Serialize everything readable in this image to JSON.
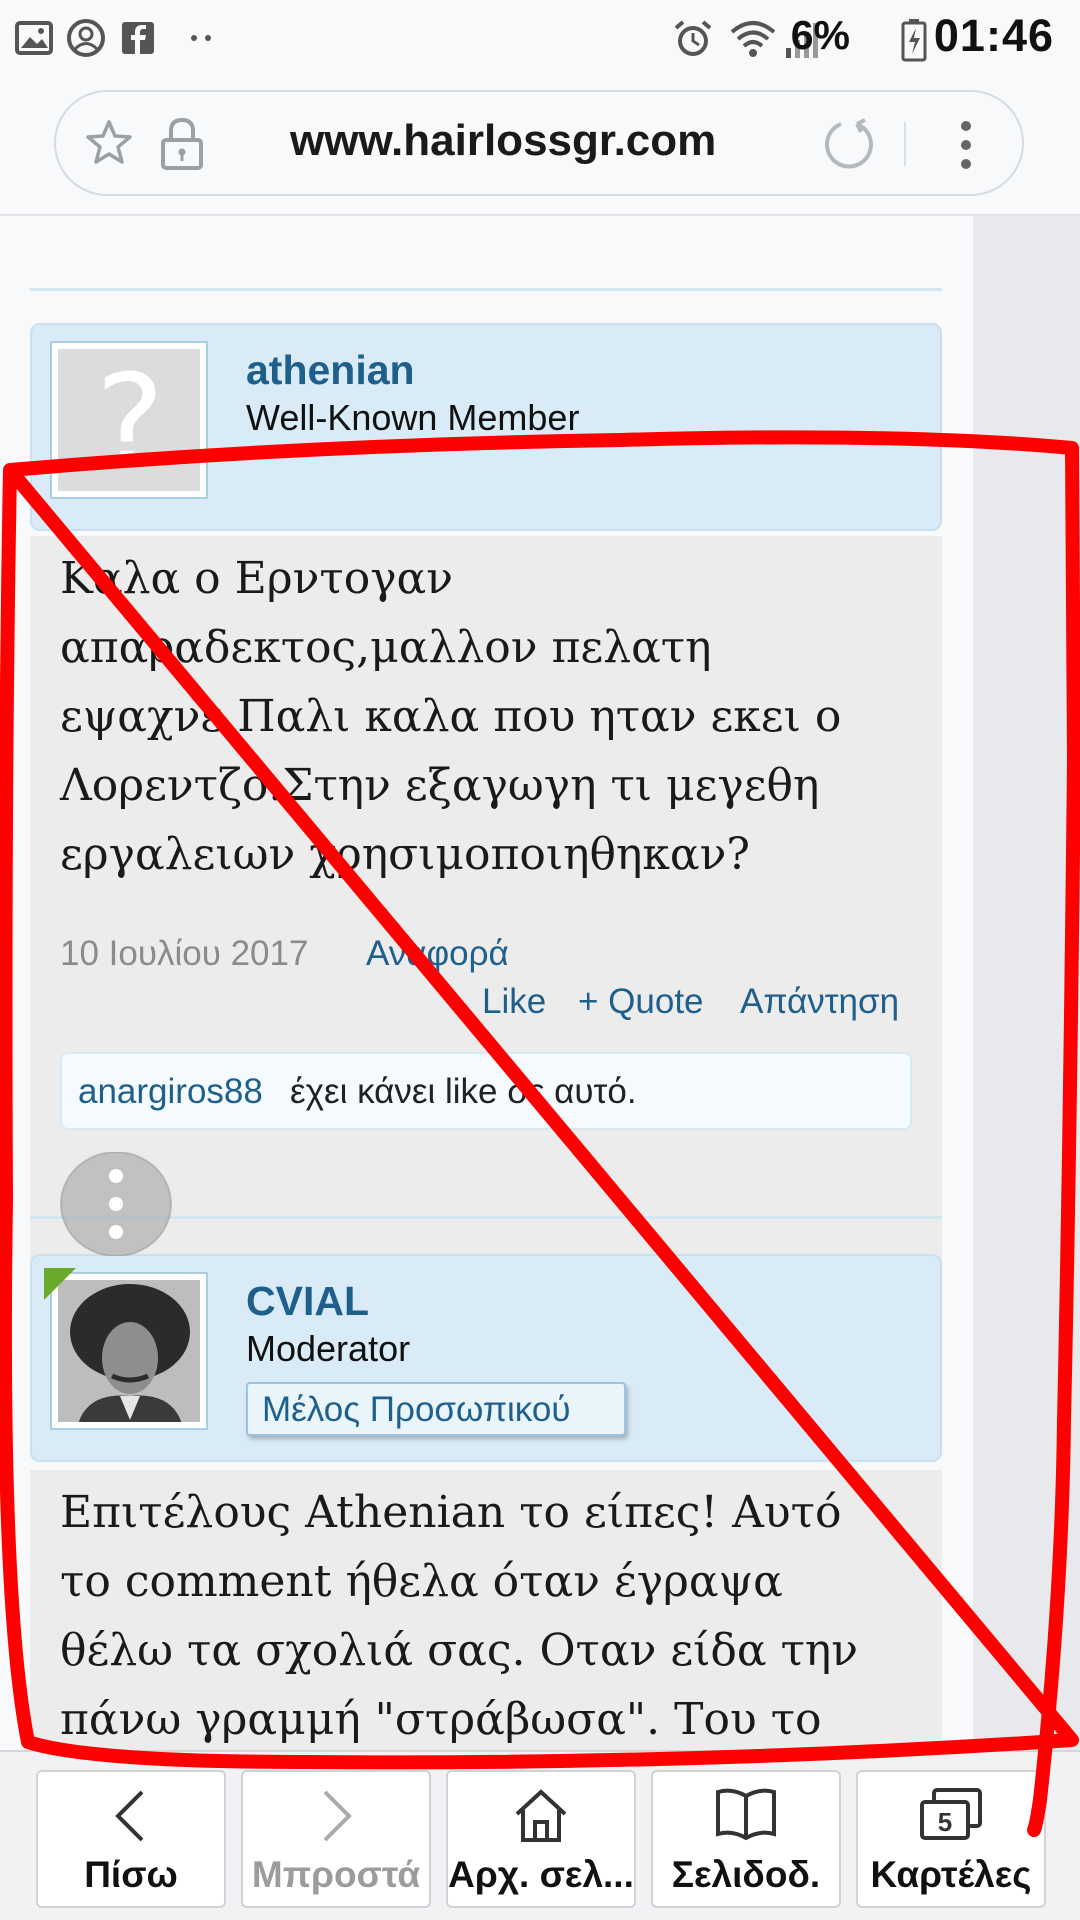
{
  "status_bar": {
    "battery_percent": "6%",
    "time": "01:46",
    "icons": [
      "image-icon",
      "account-icon",
      "facebook-icon",
      "more-dots-icon",
      "alarm-icon",
      "wifi-icon",
      "signal-icon",
      "battery-icon"
    ]
  },
  "browser": {
    "url": "www.hairlossgr.com",
    "icons": [
      "star-icon",
      "lock-icon",
      "reload-icon",
      "overflow-menu-icon"
    ]
  },
  "posts": [
    {
      "username": "athenian",
      "user_title": "Well-Known Member",
      "message_lines": [
        "Καλα ο Ερντογαν",
        "απαραδεκτος,μαλλον πελατη",
        "εψαχνε.Παλι καλα που ηταν εκει ο",
        "Λορεντζο.Στην εξαγωγη τι μεγεθη",
        "εργαλειων χρησιμοποιηθηκαν?"
      ],
      "date": "10 Ιουλίου 2017",
      "report_label": "Αναφορά",
      "like_label": "Like",
      "quote_label": "+ Quote",
      "reply_label": "Απάντηση",
      "likes_user": "anargiros88",
      "likes_text": "έχει κάνει like σε αυτό."
    },
    {
      "username": "CVIAL",
      "user_title": "Moderator",
      "staff_badge": "Μέλος Προσωπικού",
      "message_lines": [
        "Επιτέλους Athenian το είπες! Αυτό",
        "το comment ήθελα όταν έγραψα",
        "θέλω τα σχολιά σας. Οταν είδα την",
        "πάνω γραμμή \"στράβωσα\". Του το"
      ]
    }
  ],
  "bottom_nav": {
    "back": "Πίσω",
    "forward": "Μπροστά",
    "home": "Αρχ. σελ...",
    "bookmarks": "Σελιδοδ.",
    "tabs": "Καρτέλες",
    "tabs_count": "5"
  },
  "colors": {
    "link": "#1f5f8c",
    "userbar": "#d8ebf7",
    "message_bg": "#ececec",
    "annotation": "#ff0000"
  }
}
